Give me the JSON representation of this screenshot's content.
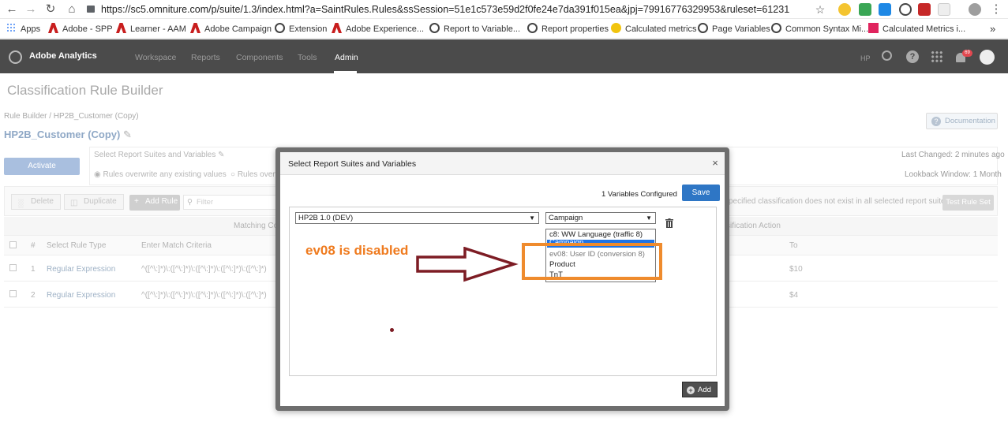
{
  "browser": {
    "url": "https://sc5.omniture.com/p/suite/1.3/index.html?a=SaintRules.Rules&ssSession=51e1c573e59d2f0fe24e7da391f015ea&jpj=79916776329953&ruleset=61231",
    "bookmarks": [
      {
        "label": "Apps",
        "icon": "apps-icon"
      },
      {
        "label": "Adobe - SPP",
        "icon": "adobe-icon"
      },
      {
        "label": "Learner - AAM",
        "icon": "adobe-icon"
      },
      {
        "label": "Adobe Campaign",
        "icon": "adobe-icon"
      },
      {
        "label": "Extension",
        "icon": "globe-icon"
      },
      {
        "label": "Adobe Experience...",
        "icon": "adobe-icon"
      },
      {
        "label": "Report to Variable...",
        "icon": "globe-icon"
      },
      {
        "label": "Report properties",
        "icon": "globe-icon"
      },
      {
        "label": "Calculated metrics",
        "icon": "cc-icon"
      },
      {
        "label": "Page Variables",
        "icon": "globe-icon"
      },
      {
        "label": "Common Syntax Mi...",
        "icon": "globe-icon"
      },
      {
        "label": "Calculated Metrics i...",
        "icon": "pink-icon"
      }
    ],
    "more": "»"
  },
  "app": {
    "brand": "Adobe Analytics",
    "nav": [
      "Workspace",
      "Reports",
      "Components",
      "Tools",
      "Admin"
    ],
    "user_initials": "HP",
    "notification_count": "69"
  },
  "page": {
    "title": "Classification Rule Builder",
    "breadcrumb": "Rule Builder / HP2B_Customer (Copy)",
    "rule_name": "HP2B_Customer (Copy)",
    "documentation": "Documentation",
    "activate": "Activate",
    "select_rs_link": "Select Report Suites and Variables",
    "radio_overwrite_any": "Rules overwrite any existing values",
    "radio_overwrite_partial": "Rules overwr",
    "last_changed": "Last Changed: 2 minutes ago",
    "lookback": "Lookback Window: 1 Month",
    "warning": "specified classification does not exist in all selected report suites",
    "toolbar": {
      "delete": "Delete",
      "duplicate": "Duplicate",
      "add_rule": "Add Rule",
      "filter_placeholder": "Filter",
      "test_rule_set": "Test Rule Set"
    },
    "group_headers": {
      "matching": "Matching Condi",
      "classification": "ssification Action"
    },
    "columns": {
      "num": "#",
      "rule_type": "Select Rule Type",
      "match": "Enter Match Criteria",
      "to": "To"
    },
    "rows": [
      {
        "num": "1",
        "type": "Regular Expression",
        "match": "^([^\\:]*)\\:([^\\:]*)\\:([^\\:]*)\\:([^\\:]*)\\:([^\\:]*)",
        "to": "$10"
      },
      {
        "num": "2",
        "type": "Regular Expression",
        "match": "^([^\\:]*)\\:([^\\:]*)\\:([^\\:]*)\\:([^\\:]*)\\:([^\\:]*)",
        "to": "$4"
      }
    ]
  },
  "dialog": {
    "title": "Select Report Suites and Variables",
    "close": "×",
    "variables_configured": "1 Variables Configured",
    "save": "Save",
    "report_suite": "HP2B 1.0 (DEV)",
    "variable": "Campaign",
    "options": [
      {
        "label": "c8: WW Language (traffic 8)",
        "selected": false,
        "disabled": false
      },
      {
        "label": "Campaign",
        "selected": true,
        "disabled": false
      },
      {
        "label": "ev08: User ID (conversion 8)",
        "selected": false,
        "disabled": true
      },
      {
        "label": "Product",
        "selected": false,
        "disabled": false
      },
      {
        "label": "TnT",
        "selected": false,
        "disabled": false
      }
    ],
    "add": "Add"
  },
  "annotation": {
    "label": "ev08 is disabled",
    "colors": {
      "orange": "#ef7b1f",
      "arrow": "#7d1c24"
    }
  }
}
